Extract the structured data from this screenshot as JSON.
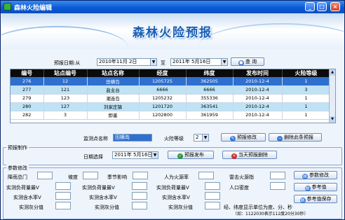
{
  "window": {
    "title": "森林火险编辑",
    "minimize": "_",
    "maximize": "□",
    "close": "×"
  },
  "banner": {
    "title": "森林火险预报"
  },
  "query": {
    "label_from": "预报日期:从",
    "date_from": "2010年11月 2日",
    "label_to": "至",
    "date_to": "2011年 5月16日",
    "search_label": "查 询"
  },
  "table": {
    "columns": [
      "编号",
      "站点编号",
      "站点名称",
      "经度",
      "纬度",
      "发布时间",
      "火险等级"
    ],
    "rows": [
      [
        "276",
        "12",
        "田横岛",
        "1205725",
        "362505",
        "2010-12-4",
        "1"
      ],
      [
        "277",
        "121",
        "盐业台",
        "6666",
        "6666",
        "2010-12-4",
        "3"
      ],
      [
        "279",
        "123",
        "潮连岛",
        "1205232",
        "355336",
        "2010-12-4",
        "1"
      ],
      [
        "280",
        "127",
        "刘家庄镇",
        "1201720",
        "363541",
        "2010-12-4",
        "1"
      ],
      [
        "282",
        "3",
        "即墨",
        "1202800",
        "361959",
        "2010-12-4",
        "1"
      ]
    ]
  },
  "edit": {
    "station_label": "监测点名称",
    "station_value": "田横岛",
    "level_label": "火险等级",
    "level_value": "2",
    "modify_label": "预报修改",
    "delete_label": "删除此条预报"
  },
  "produce": {
    "legend": "预报制作",
    "date_label": "日期选择",
    "date_value": "2011年 5月16日",
    "publish_label": "预报发布",
    "delete_today_label": "当天预报删除"
  },
  "params": {
    "legend": "参数修改",
    "labels": {
      "rainfall": "降雨总门",
      "slope": "坡度",
      "season": "季节影响",
      "human": "人为火源率",
      "lightning": "雷击火源指",
      "dry_v": "实测负荷量最V",
      "dry_v2": "实测负荷量最V",
      "dry_v3": "实测负荷量最V",
      "population": "人口密度",
      "moist_v": "实测含水率V",
      "moist_v2": "实测含水率V",
      "moist_v3": "实测含水率V",
      "ash": "实测灰分值",
      "ash2": "实测灰分值",
      "ash3": "实测灰分值"
    },
    "note": "经、纬度显示单位为度、分、秒",
    "example": "（如：1122030表示112度20分30秒）",
    "btn_modify": "参数修改",
    "btn_reference": "参考值",
    "btn_save_reference": "参考值保存"
  },
  "colors": {
    "titlebar": "#0a5ad6",
    "selected_row": "#2f6fd0",
    "alt_row": "#bfe3f5",
    "header": "#0b0b0b"
  },
  "icons": {
    "search": "search-icon",
    "check": "check-icon",
    "close": "close-circle-icon",
    "document": "document-icon"
  }
}
